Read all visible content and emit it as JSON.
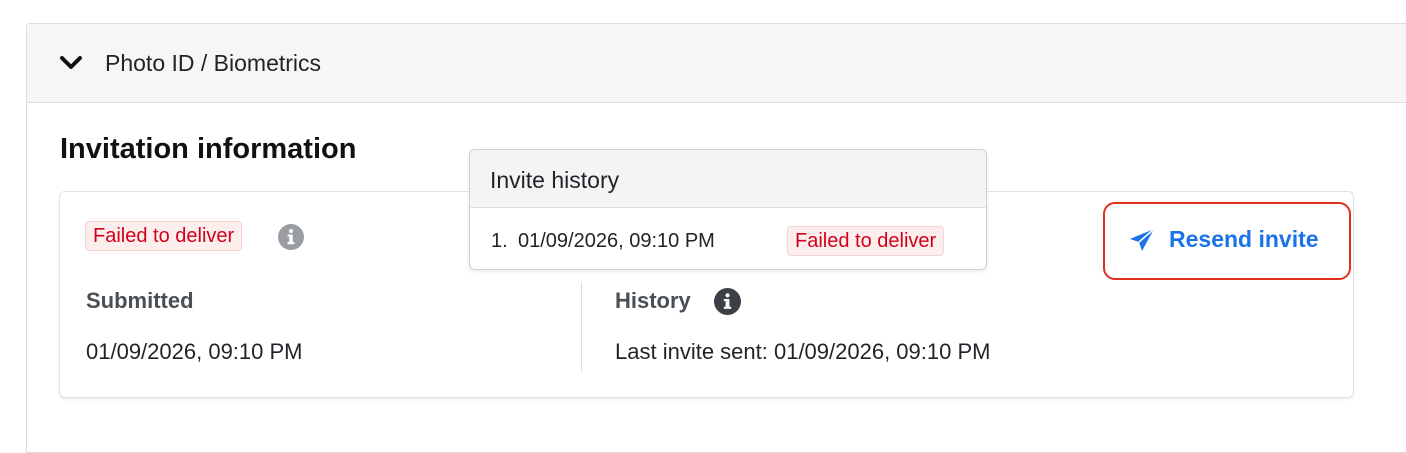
{
  "section": {
    "title": "Photo ID / Biometrics",
    "chevron_icon": "chevron-down-icon"
  },
  "invitation": {
    "heading": "Invitation information",
    "status_badge": "Failed to deliver",
    "status_color": "#d0021b",
    "submitted_label": "Submitted",
    "submitted_value": "01/09/2026, 09:10 PM",
    "history_label": "History",
    "last_invite": "Last invite sent: 01/09/2026, 09:10 PM",
    "resend_label": "Resend invite",
    "resend_icon": "paper-plane-icon",
    "accent_color": "#1a73e8"
  },
  "invite_history_popover": {
    "title": "Invite history",
    "items": [
      {
        "index": "1.",
        "date": "01/09/2026, 09:10 PM",
        "status": "Failed to deliver"
      }
    ]
  }
}
